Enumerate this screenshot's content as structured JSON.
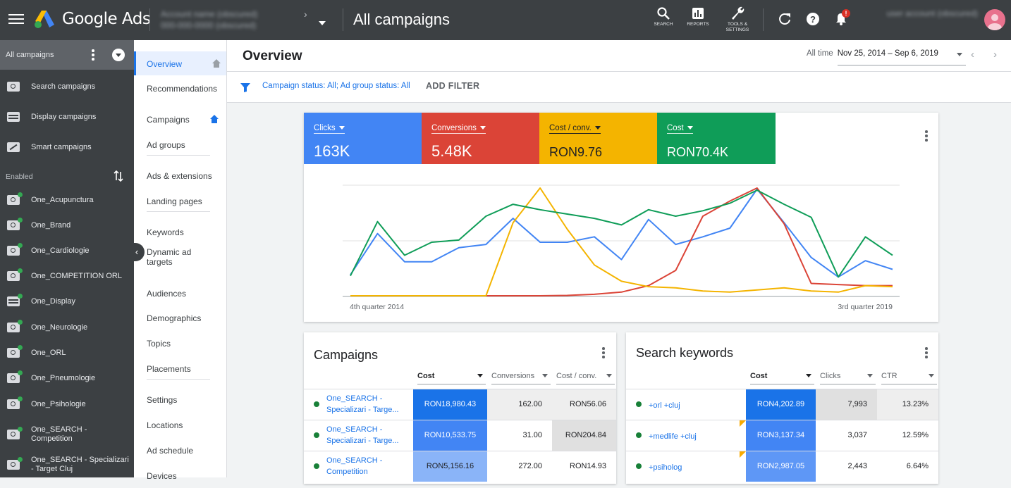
{
  "header": {
    "brand": "Google Ads",
    "account_name_blurred": "Account name (obscured)",
    "account_id_blurred": "000-000-0000 (obscured)",
    "page_title": "All campaigns",
    "icons": [
      {
        "name": "search-icon",
        "label": "SEARCH"
      },
      {
        "name": "reports-icon",
        "label": "REPORTS"
      },
      {
        "name": "tools-icon",
        "label": "TOOLS & SETTINGS"
      }
    ],
    "notifications_badge": "!",
    "user_blurred": "user account (obscured)"
  },
  "leftnav": {
    "header_label": "All campaigns",
    "types": [
      {
        "label": "Search campaigns",
        "icon": "search"
      },
      {
        "label": "Display campaigns",
        "icon": "disp"
      },
      {
        "label": "Smart campaigns",
        "icon": "smart"
      }
    ],
    "filter_label": "Enabled",
    "campaigns": [
      {
        "label": "One_Acupunctura",
        "icon": "search"
      },
      {
        "label": "One_Brand",
        "icon": "search"
      },
      {
        "label": "One_Cardiologie",
        "icon": "search"
      },
      {
        "label": "One_COMPETITION ORL",
        "icon": "search"
      },
      {
        "label": "One_Display",
        "icon": "disp"
      },
      {
        "label": "One_Neurologie",
        "icon": "search"
      },
      {
        "label": "One_ORL",
        "icon": "search"
      },
      {
        "label": "One_Pneumologie",
        "icon": "search"
      },
      {
        "label": "One_Psihologie",
        "icon": "search"
      },
      {
        "label": "One_SEARCH - Competition",
        "icon": "search"
      },
      {
        "label": "One_SEARCH - Specializari - Target Cluj",
        "icon": "search"
      }
    ]
  },
  "subnav": {
    "items": [
      "Overview",
      "Recommendations",
      "Campaigns",
      "Ad groups",
      "Ads & extensions",
      "Landing pages",
      "Keywords",
      "Dynamic ad targets",
      "Audiences",
      "Demographics",
      "Topics",
      "Placements",
      "Settings",
      "Locations",
      "Ad schedule",
      "Devices"
    ]
  },
  "overview": {
    "title": "Overview",
    "date_label": "All time",
    "date_range": "Nov 25, 2014 – Sep 6, 2019",
    "filter_text": "Campaign status: ",
    "filter_val1": "All",
    "filter_sep": "; Ad group status: ",
    "filter_val2": "All",
    "add_filter": "ADD FILTER"
  },
  "metrics": [
    {
      "label": "Clicks",
      "value": "163K",
      "color": "#4285f4"
    },
    {
      "label": "Conversions",
      "value": "5.48K",
      "color": "#db4437"
    },
    {
      "label": "Cost / conv.",
      "value": "RON9.76",
      "color": "#f4b400"
    },
    {
      "label": "Cost",
      "value": "RON70.4K",
      "color": "#0f9d58"
    }
  ],
  "chart_data": {
    "type": "line",
    "x_start_label": "4th quarter 2014",
    "x_end_label": "3rd quarter 2019",
    "series": [
      {
        "name": "Clicks",
        "color": "#4285f4",
        "values": [
          0.2,
          0.58,
          0.32,
          0.32,
          0.45,
          0.48,
          0.72,
          0.5,
          0.5,
          0.55,
          0.34,
          0.71,
          0.48,
          0.55,
          0.63,
          0.99,
          0.68,
          0.36,
          0.18,
          0.33,
          0.25
        ]
      },
      {
        "name": "Conversions",
        "color": "#db4437",
        "values": [
          0.0,
          0.0,
          0.0,
          0.0,
          0.0,
          0.0,
          0.0,
          0.0,
          0.01,
          0.02,
          0.04,
          0.1,
          0.24,
          0.74,
          0.88,
          1.0,
          0.67,
          0.12,
          0.11,
          0.1,
          0.1
        ]
      },
      {
        "name": "Cost / conv.",
        "color": "#f4b400",
        "values": [
          0.0,
          0.0,
          0.0,
          0.0,
          0.0,
          0.0,
          0.68,
          1.0,
          0.62,
          0.29,
          0.14,
          0.09,
          0.08,
          0.05,
          0.04,
          0.06,
          0.08,
          0.05,
          0.04,
          0.1,
          0.09
        ]
      },
      {
        "name": "Cost",
        "color": "#0f9d58",
        "values": [
          0.19,
          0.69,
          0.38,
          0.5,
          0.52,
          0.74,
          0.85,
          0.8,
          0.76,
          0.72,
          0.66,
          0.8,
          0.74,
          0.79,
          0.86,
          0.98,
          0.85,
          0.73,
          0.18,
          0.55,
          0.38
        ]
      }
    ]
  },
  "campaigns_table": {
    "title": "Campaigns",
    "headers": [
      "Cost",
      "Conversions",
      "Cost / conv."
    ],
    "rows": [
      {
        "name": "One_SEARCH - Specializari - Targe...",
        "cost": "RON18,980.43",
        "conv": "162.00",
        "cpc": "RON56.06"
      },
      {
        "name": "One_SEARCH - Specializari - Targe...",
        "cost": "RON10,533.75",
        "conv": "31.00",
        "cpc": "RON204.84"
      },
      {
        "name": "One_SEARCH - Competition",
        "cost": "RON5,156.16",
        "conv": "272.00",
        "cpc": "RON14.93"
      }
    ]
  },
  "keywords_table": {
    "title": "Search keywords",
    "headers": [
      "Cost",
      "Clicks",
      "CTR"
    ],
    "rows": [
      {
        "name": "+orl +cluj",
        "cost": "RON4,202.89",
        "clicks": "7,993",
        "ctr": "13.23%"
      },
      {
        "name": "+medlife +cluj",
        "cost": "RON3,137.34",
        "clicks": "3,037",
        "ctr": "12.59%"
      },
      {
        "name": "+psiholog",
        "cost": "RON2,987.05",
        "clicks": "2,443",
        "ctr": "6.64%"
      }
    ]
  }
}
